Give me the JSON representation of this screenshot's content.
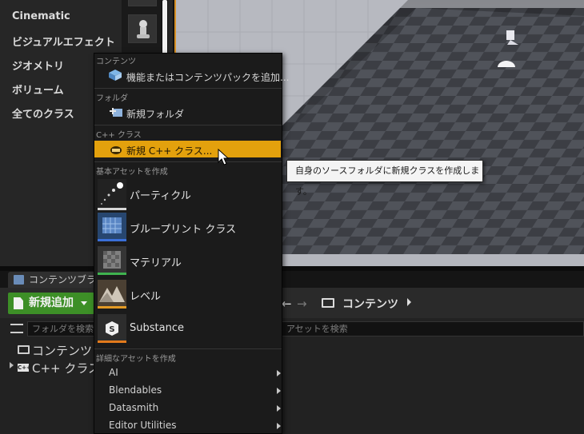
{
  "place_panel": {
    "categories": [
      "Cinematic",
      "ビジュアルエフェクト",
      "ジオメトリ",
      "ボリューム",
      "全てのクラス"
    ]
  },
  "content_browser": {
    "tab_label": "コンテンツブラ",
    "add_new_label": "新規追加",
    "path_label": "コンテンツ",
    "folder_search_placeholder": "フォルダを検索",
    "asset_search_placeholder": "アセットを検索",
    "tree": [
      "コンテンツ",
      "C++ クラス"
    ],
    "cpp_badge": "C++"
  },
  "menu": {
    "sections": {
      "content": "コンテンツ",
      "folder": "フォルダ",
      "cpp": "C++ クラス",
      "basic": "基本アセットを作成",
      "advanced": "詳細なアセットを作成"
    },
    "add_feature": "機能またはコンテンツパックを追加...",
    "new_folder": "新規フォルダ",
    "new_cpp_class": "新規 C++ クラス...",
    "basic_assets": [
      "パーティクル",
      "ブループリント クラス",
      "マテリアル",
      "レベル",
      "Substance"
    ],
    "advanced_items": [
      "AI",
      "Blendables",
      "Datasmith",
      "Editor Utilities"
    ]
  },
  "tooltip": "自身のソースフォルダに新規クラスを作成します。",
  "colors": {
    "highlight": "#e3a10d",
    "add_new_green": "#3d8f27",
    "viewport_border": "#d78f22"
  }
}
